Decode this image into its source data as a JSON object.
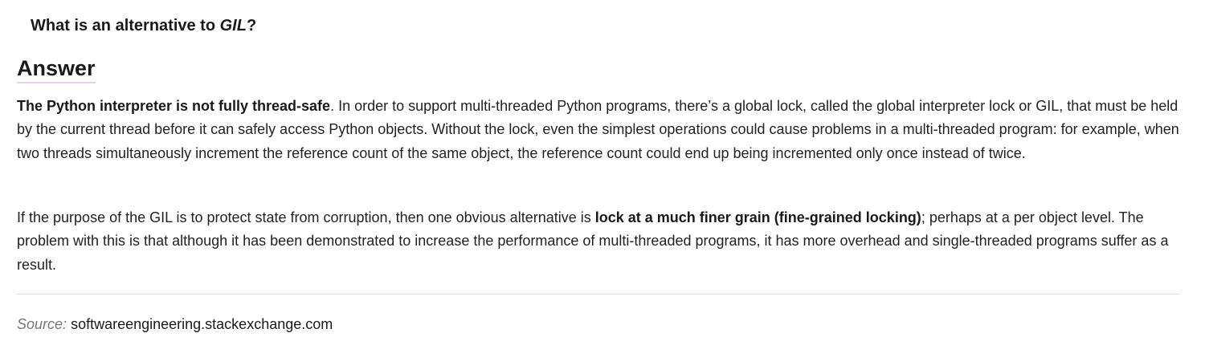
{
  "question": {
    "prefix": "What is an alternative to ",
    "term": "GIL",
    "suffix": "?"
  },
  "answer": {
    "heading": "Answer",
    "paragraph1": {
      "bold": "The Python interpreter is not fully thread-safe",
      "rest": ". In order to support multi-threaded Python programs, there’s a global lock, called the global interpreter lock or GIL, that must be held by the current thread before it can safely access Python objects. Without the lock, even the simplest operations could cause problems in a multi-threaded program: for example, when two threads simultaneously increment the reference count of the same object, the reference count could end up being incremented only once instead of twice."
    },
    "paragraph2": {
      "before": "If the purpose of the GIL is to protect state from corruption, then one obvious alternative is ",
      "bold": "lock at a much finer grain (fine-grained locking)",
      "after": "; perhaps at a per object level. The problem with this is that although it has been demonstrated to increase the performance of multi-threaded programs, it has more overhead and single-threaded programs suffer as a result."
    }
  },
  "source": {
    "label": "Source:",
    "value": "softwareengineering.stackexchange.com"
  }
}
